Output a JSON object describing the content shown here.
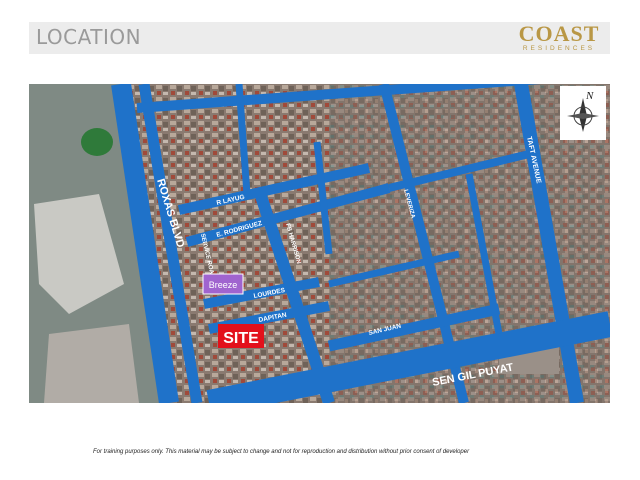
{
  "header": {
    "title": "LOCATION",
    "logo_name": "COAST",
    "logo_sub": "RESIDENCES"
  },
  "map": {
    "compass_label": "N",
    "streets": {
      "roxas_blvd": "ROXAS BLVD",
      "service_road": "SERVICE ROAD",
      "fb_harrison": "FB HARRISON",
      "leveriza": "LEVERIZA",
      "taft_avenue": "TAFT AVENUE",
      "r_layug": "R LAYUG",
      "e_rodriguez": "E. RODRIGUEZ",
      "lourdes": "LOURDES",
      "dapitan": "DAPITAN",
      "san_juan": "SAN JUAN",
      "sen_gil_puyat": "SEN GIL PUYAT"
    },
    "markers": {
      "breeze": "Breeze",
      "site": "SITE"
    },
    "colors": {
      "road": "#1f72c9",
      "site": "#e3101b",
      "breeze": "#a064cf"
    }
  },
  "footer": {
    "disclaimer": "For training purposes only. This material may be subject to change and not for reproduction and distribution without prior consent of developer"
  }
}
